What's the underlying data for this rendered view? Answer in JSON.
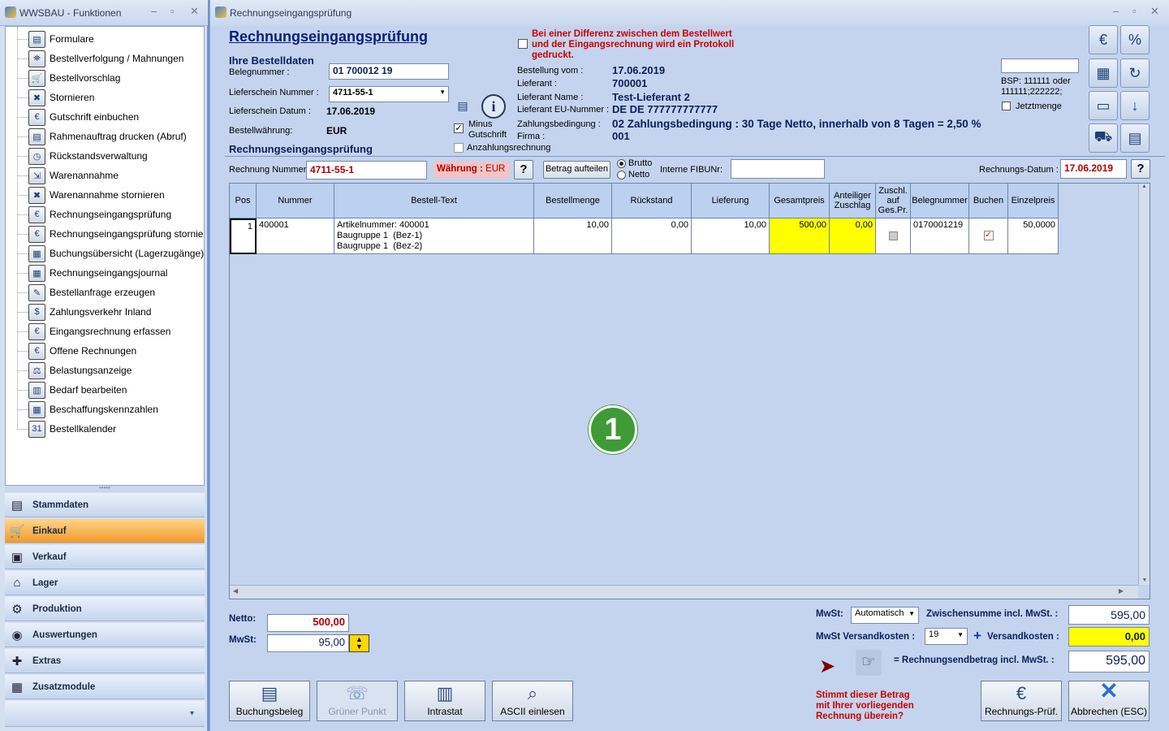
{
  "left": {
    "title": "WWSBAU - Funktionen",
    "tree": [
      {
        "label": "Formulare",
        "icon": "form-icon",
        "g": "▤"
      },
      {
        "label": "Bestellverfolgung / Mahnungen",
        "icon": "map-icon",
        "g": "⛯"
      },
      {
        "label": "Bestellvorschlag",
        "icon": "cart-icon",
        "g": "🛒"
      },
      {
        "label": "Stornieren",
        "icon": "cart-cancel-icon",
        "g": "✖"
      },
      {
        "label": "Gutschrift einbuchen",
        "icon": "credit-icon",
        "g": "€"
      },
      {
        "label": "Rahmenauftrag drucken (Abruf)",
        "icon": "print-doc-icon",
        "g": "▤"
      },
      {
        "label": "Rückstandsverwaltung",
        "icon": "clock-icon",
        "g": "◷"
      },
      {
        "label": "Warenannahme",
        "icon": "hand-truck-icon",
        "g": "⇲"
      },
      {
        "label": "Warenannahme stornieren",
        "icon": "hand-truck-cancel-icon",
        "g": "✖"
      },
      {
        "label": "Rechnungseingangsprüfung",
        "icon": "euro-doc-icon",
        "g": "€"
      },
      {
        "label": "Rechnungseingangsprüfung stornieren",
        "icon": "euro-cancel-icon",
        "g": "€"
      },
      {
        "label": "Buchungsübersicht (Lagerzugänge)",
        "icon": "ledger-icon",
        "g": "▦"
      },
      {
        "label": "Rechnungseingangsjournal",
        "icon": "journal-icon",
        "g": "▦"
      },
      {
        "label": "Bestellanfrage erzeugen",
        "icon": "request-icon",
        "g": "✎"
      },
      {
        "label": "Zahlungsverkehr Inland",
        "icon": "payment-icon",
        "g": "$"
      },
      {
        "label": "Eingangsrechnung erfassen",
        "icon": "invoice-capture-icon",
        "g": "€"
      },
      {
        "label": "Offene Rechnungen",
        "icon": "open-invoice-icon",
        "g": "€"
      },
      {
        "label": "Belastungsanzeige",
        "icon": "weight-icon",
        "g": "⚖"
      },
      {
        "label": "Bedarf bearbeiten",
        "icon": "basket-icon",
        "g": "▥"
      },
      {
        "label": "Beschaffungskennzahlen",
        "icon": "calculator-icon",
        "g": "▦"
      },
      {
        "label": "Bestellkalender",
        "icon": "calendar-icon",
        "g": "31"
      }
    ],
    "modules": [
      {
        "label": "Stammdaten",
        "icon": "database-icon",
        "g": "▤"
      },
      {
        "label": "Einkauf",
        "icon": "cart-icon",
        "g": "🛒",
        "active": true
      },
      {
        "label": "Verkauf",
        "icon": "cash-register-icon",
        "g": "▣"
      },
      {
        "label": "Lager",
        "icon": "warehouse-icon",
        "g": "⌂"
      },
      {
        "label": "Produktion",
        "icon": "production-icon",
        "g": "⚙"
      },
      {
        "label": "Auswertungen",
        "icon": "analytics-icon",
        "g": "◉"
      },
      {
        "label": "Extras",
        "icon": "extras-icon",
        "g": "✚"
      },
      {
        "label": "Zusatzmodule",
        "icon": "modules-icon",
        "g": "▦"
      }
    ]
  },
  "main": {
    "window_title": "Rechnungseingangsprüfung",
    "heading": "Rechnungseingangsprüfung",
    "bestell_heading": "Ihre Bestelldaten",
    "belegnummer_label": "Belegnummer :",
    "belegnummer_value": "01 700012 19",
    "lieferschein_nr_label": "Lieferschein Nummer :",
    "lieferschein_nr_value": "4711-55-1",
    "lieferschein_datum_label": "Lieferschein Datum :",
    "lieferschein_datum_value": "17.06.2019",
    "waehrung_label": "Bestellwährung:",
    "waehrung_value": "EUR",
    "sub_heading": "Rechnungseingangsprüfung",
    "minus_gutschrift_label": "Minus\nGutschrift",
    "anzahlung_label": "Anzahlungsrechnung",
    "protokoll_text": "Bei einer Differenz zwischen dem Bestellwert\nund der Eingangsrechnung wird ein Protokoll\ngedruckt.",
    "info": [
      {
        "label": "Bestellung vom :",
        "value": "17.06.2019"
      },
      {
        "label": "Lieferant :",
        "value": "700001"
      },
      {
        "label": "Lieferant Name :",
        "value": "Test-Lieferant 2"
      },
      {
        "label": "Lieferant EU-Nummer :",
        "value": "DE   DE 777777777777"
      },
      {
        "label": "Zahlungsbedingung :",
        "value": "02    Zahlungsbedingung : 30 Tage Netto, innerhalb von 8 Tagen = 2,50 %"
      },
      {
        "label": "Firma :",
        "value": "001"
      }
    ],
    "bsp_text": "BSP: 111111 oder\n111111;222222;",
    "jetztmenge_label": "Jetztmenge",
    "rechnung_nr_label": "Rechnung Nummer",
    "rechnung_nr_value": "4711-55-1",
    "waehrung2_label": "Währung :",
    "waehrung2_value": "EUR",
    "betrag_aufteilen": "Betrag aufteilen",
    "brutto": "Brutto",
    "netto": "Netto",
    "fibu_label": "Interne FIBUNr:",
    "rechnungs_datum_label": "Rechnungs-Datum :",
    "rechnungs_datum_value": "17.06.2019",
    "help": "?",
    "columns": [
      "Pos",
      "Nummer",
      "Bestell-Text",
      "Bestellmenge",
      "Rückstand",
      "Lieferung",
      "Gesamtpreis",
      "Anteiliger Zuschlag",
      "Zuschl. auf Ges.Pr.",
      "Belegnummer",
      "Buchen",
      "Einzelpreis"
    ],
    "row": {
      "pos": "1",
      "nummer": "400001",
      "text": "Artikelnummer: 400001\nBaugruppe 1  (Bez-1)\nBaugruppe 1  (Bez-2)",
      "bestellmenge": "10,00",
      "rueckstand": "0,00",
      "lieferung": "10,00",
      "gesamtpreis": "500,00",
      "zuschlag": "0,00",
      "belegnummer": "0170001219",
      "einzelpreis": "50,0000"
    },
    "badge": "1",
    "netto_label": "Netto:",
    "netto_value": "500,00",
    "mwst_label": "MwSt:",
    "mwst_value": "95,00",
    "mwst_sel_label": "MwSt:",
    "mwst_sel_value": "Automatisch",
    "zwischensumme_label": "Zwischensumme incl. MwSt. :",
    "zwischensumme_value": "595,00",
    "mwst_versand_label": "MwSt Versandkosten :",
    "mwst_versand_value": "19",
    "versandkosten_label": "Versandkosten :",
    "versandkosten_value": "0,00",
    "endbetrag_label": "= Rechnungsendbetrag incl. MwSt. :",
    "endbetrag_value": "595,00",
    "stimmt_text": "Stimmt dieser Betrag\nmit Ihrer vorliegenden\nRechnung überein?",
    "buttons": [
      {
        "label": "Buchungsbeleg",
        "icon": "document-icon",
        "g": "▤"
      },
      {
        "label": "Grüner Punkt",
        "icon": "green-dot-icon",
        "g": "☏",
        "disabled": true
      },
      {
        "label": "Intrastat",
        "icon": "bar-chart-icon",
        "g": "▥"
      },
      {
        "label": "ASCII einlesen",
        "icon": "ascii-import-icon",
        "g": "⌕"
      }
    ],
    "pruef_button": "Rechnungs-Prüf.",
    "abbrechen_button": "Abbrechen (ESC)"
  }
}
